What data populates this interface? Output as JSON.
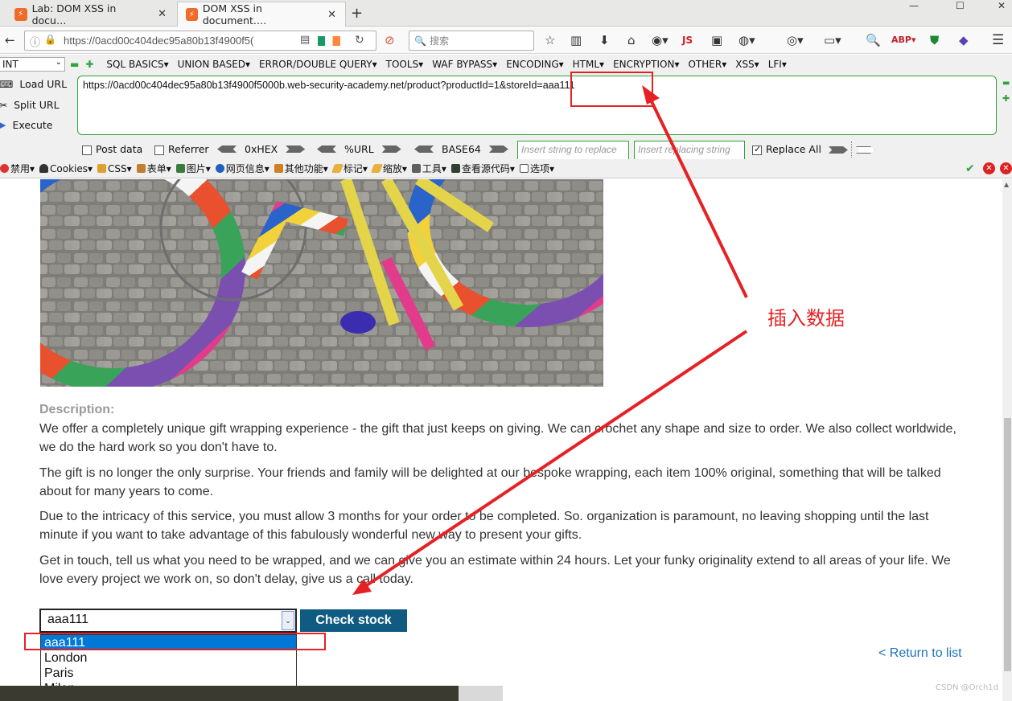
{
  "tabs": [
    {
      "title": "Lab: DOM XSS in docu…",
      "icon": "flame-icon"
    },
    {
      "title": "DOM XSS in document.…",
      "icon": "flame-icon"
    }
  ],
  "nav": {
    "url": "https://0acd00c404dec95a80b13f4900f5(",
    "search_placeholder": "搜索"
  },
  "hackbar": {
    "select_value": "INT",
    "menu": [
      "SQL BASICS▾",
      "UNION BASED▾",
      "ERROR/DOUBLE QUERY▾",
      "TOOLS▾",
      "WAF BYPASS▾",
      "ENCODING▾",
      "HTML▾",
      "ENCRYPTION▾",
      "OTHER▾",
      "XSS▾",
      "LFI▾"
    ],
    "load_url": "Load URL",
    "split_url": "Split URL",
    "execute": "Execute",
    "url_value": "https://0acd00c404dec95a80b13f4900f5000b.web-security-academy.net/product?productId=1&storeId=aaa111",
    "post_data": "Post data",
    "referrer": "Referrer",
    "hex": "0xHEX",
    "url_enc": "%URL",
    "base64": "BASE64",
    "insert_placeholder": "Insert string to replace",
    "replacing_placeholder": "Insert replacing string",
    "replace_all": "Replace All"
  },
  "webdev": [
    "禁用▾",
    "Cookies▾",
    "CSS▾",
    "表单▾",
    "图片▾",
    "网页信息▾",
    "其他功能▾",
    "标记▾",
    "缩放▾",
    "工具▾",
    "查看源代码▾",
    "选项▾"
  ],
  "page": {
    "description_label": "Description:",
    "paragraphs": [
      "We offer a completely unique gift wrapping experience - the gift that just keeps on giving. We can crochet any shape and size to order. We also collect worldwide, we do the hard work so you don't have to.",
      "The gift is no longer the only surprise. Your friends and family will be delighted at our bespoke wrapping, each item 100% original, something that will be talked about for many years to come.",
      "Due to the intricacy of this service, you must allow 3 months for your order to be completed. So. organization is paramount, no leaving shopping until the last minute if you want to take advantage of this fabulously wonderful new way to present your gifts.",
      "Get in touch, tell us what you need to be wrapped, and we can give you an estimate within 24 hours. Let your funky originality extend to all areas of your life. We love every project we work on, so don't delay, give us a call today."
    ],
    "store_selected": "aaa111",
    "store_options": [
      "aaa111",
      "London",
      "Paris",
      "Milan"
    ],
    "check_stock": "Check stock",
    "return_link": "< Return to list"
  },
  "annotation": {
    "label": "插入数据",
    "color": "#e62124"
  },
  "watermark": "CSDN @Orch1d"
}
